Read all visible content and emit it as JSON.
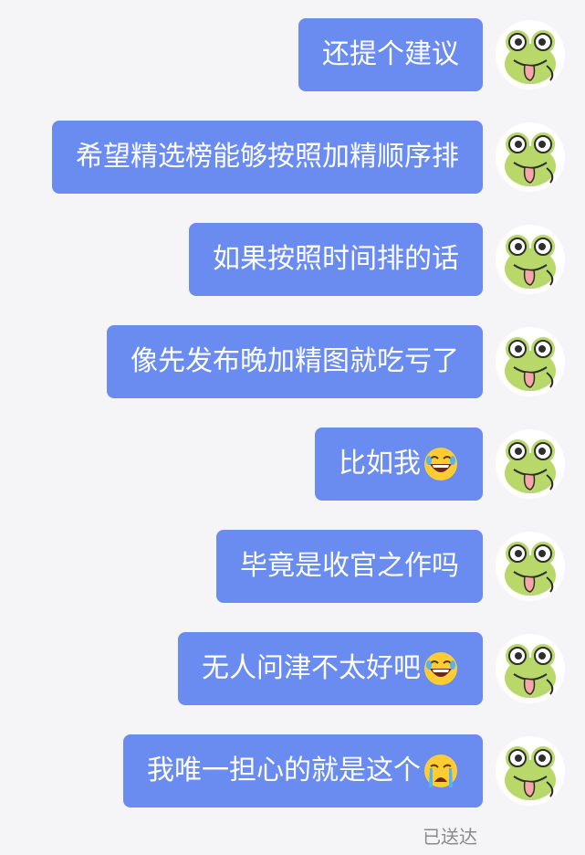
{
  "messages": [
    {
      "text": "还提个建议",
      "emoji": ""
    },
    {
      "text": "希望精选榜能够按照加精顺序排",
      "emoji": ""
    },
    {
      "text": "如果按照时间排的话",
      "emoji": ""
    },
    {
      "text": "像先发布晚加精图就吃亏了",
      "emoji": ""
    },
    {
      "text": "比如我",
      "emoji": "rolling-laughing-emoji"
    },
    {
      "text": "毕竟是收官之作吗",
      "emoji": ""
    },
    {
      "text": "无人问津不太好吧",
      "emoji": "rolling-laughing-emoji"
    },
    {
      "text": "我唯一担心的就是这个",
      "emoji": "crying-emoji"
    }
  ],
  "status": "已送达",
  "colors": {
    "bubble": "#6a8cf0",
    "background": "#f5f5f7",
    "status": "#8a8a8a"
  },
  "avatar": {
    "icon": "frog-avatar-icon"
  }
}
